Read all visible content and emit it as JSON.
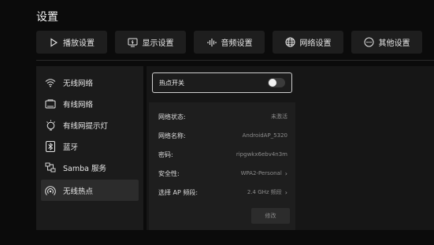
{
  "page_title": "设置",
  "tabs": [
    {
      "label": "播放设置",
      "icon": "play-icon"
    },
    {
      "label": "显示设置",
      "icon": "display-icon"
    },
    {
      "label": "音频设置",
      "icon": "audio-wave-icon"
    },
    {
      "label": "网络设置",
      "icon": "globe-icon"
    },
    {
      "label": "其他设置",
      "icon": "more-icon"
    }
  ],
  "sidebar": {
    "items": [
      {
        "label": "无线网络",
        "icon": "wifi-icon"
      },
      {
        "label": "有线网络",
        "icon": "ethernet-icon"
      },
      {
        "label": "有线网提示灯",
        "icon": "bulb-icon"
      },
      {
        "label": "蓝牙",
        "icon": "bluetooth-icon"
      },
      {
        "label": "Samba 服务",
        "icon": "samba-icon"
      },
      {
        "label": "无线热点",
        "icon": "hotspot-icon"
      }
    ],
    "active_index": 5
  },
  "hotspot": {
    "toggle_label": "热点开关",
    "toggle_on": false,
    "info": {
      "status_label": "网络状态:",
      "status_value": "未激活",
      "name_label": "网络名称:",
      "name_value": "AndroidAP_5320",
      "password_label": "密码:",
      "password_value": "ripgwkx6ebv4n3m",
      "security_label": "安全性:",
      "security_value": "WPA2-Personal",
      "band_label": "选择 AP 频段:",
      "band_value": "2.4 GHz 频段"
    },
    "modify_label": "修改"
  },
  "colors": {
    "background": "#0b0b0b",
    "panel": "#1e1e1e",
    "active_item": "#2c2c2c",
    "focus_border": "#cfcfcf"
  }
}
